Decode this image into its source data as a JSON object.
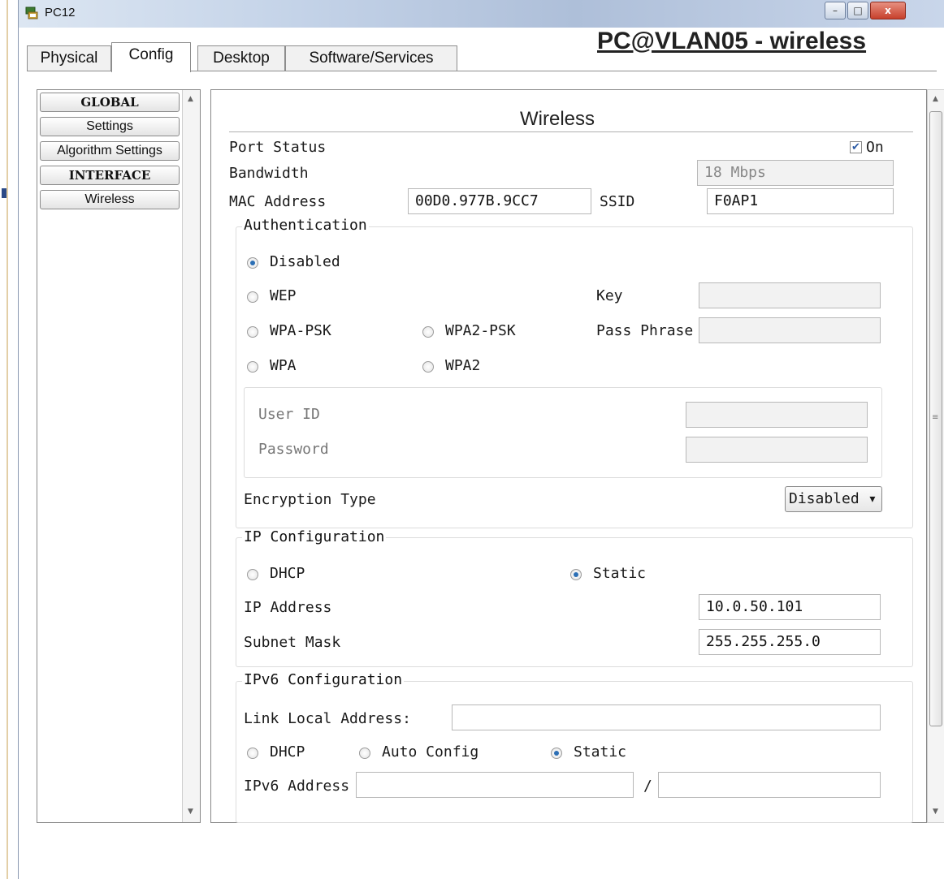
{
  "window": {
    "title": "PC12",
    "controls": {
      "minimize": "–",
      "maximize": "□",
      "close": "x"
    }
  },
  "annotation": "PC@VLAN05 - wireless",
  "tabs": [
    "Physical",
    "Config",
    "Desktop",
    "Software/Services"
  ],
  "active_tab": "Config",
  "sidebar": {
    "items": [
      {
        "label": "GLOBAL",
        "header": true
      },
      {
        "label": "Settings"
      },
      {
        "label": "Algorithm Settings"
      },
      {
        "label": "INTERFACE",
        "header": true
      },
      {
        "label": "Wireless"
      }
    ]
  },
  "panel": {
    "title": "Wireless",
    "port_status": {
      "label": "Port Status",
      "checked": true,
      "on_label": "On",
      "check_glyph": "✔"
    },
    "bandwidth": {
      "label": "Bandwidth",
      "value": "18 Mbps"
    },
    "mac": {
      "label": "MAC Address",
      "value": "00D0.977B.9CC7"
    },
    "ssid": {
      "label": "SSID",
      "value": "F0AP1"
    },
    "auth": {
      "legend": "Authentication",
      "options": {
        "disabled": "Disabled",
        "wep": "WEP",
        "wpa_psk": "WPA-PSK",
        "wpa2_psk": "WPA2-PSK",
        "wpa": "WPA",
        "wpa2": "WPA2"
      },
      "selected": "Disabled",
      "key_label": "Key",
      "passphrase_label": "Pass Phrase",
      "user_id_label": "User ID",
      "password_label": "Password",
      "encryption_label": "Encryption Type",
      "encryption_value": "Disabled"
    },
    "ip": {
      "legend": "IP Configuration",
      "dhcp_label": "DHCP",
      "static_label": "Static",
      "selected": "Static",
      "ip_address_label": "IP Address",
      "ip_address": "10.0.50.101",
      "subnet_label": "Subnet Mask",
      "subnet": "255.255.255.0"
    },
    "ipv6": {
      "legend": "IPv6 Configuration",
      "link_local_label": "Link Local Address:",
      "link_local": "",
      "dhcp_label": "DHCP",
      "auto_label": "Auto Config",
      "static_label": "Static",
      "selected": "Static",
      "address_label": "IPv6 Address",
      "address": "",
      "slash": "/",
      "prefix": ""
    }
  },
  "glyphs": {
    "up": "▲",
    "down": "▼",
    "grip": "≡",
    "dropdown": "▾"
  }
}
